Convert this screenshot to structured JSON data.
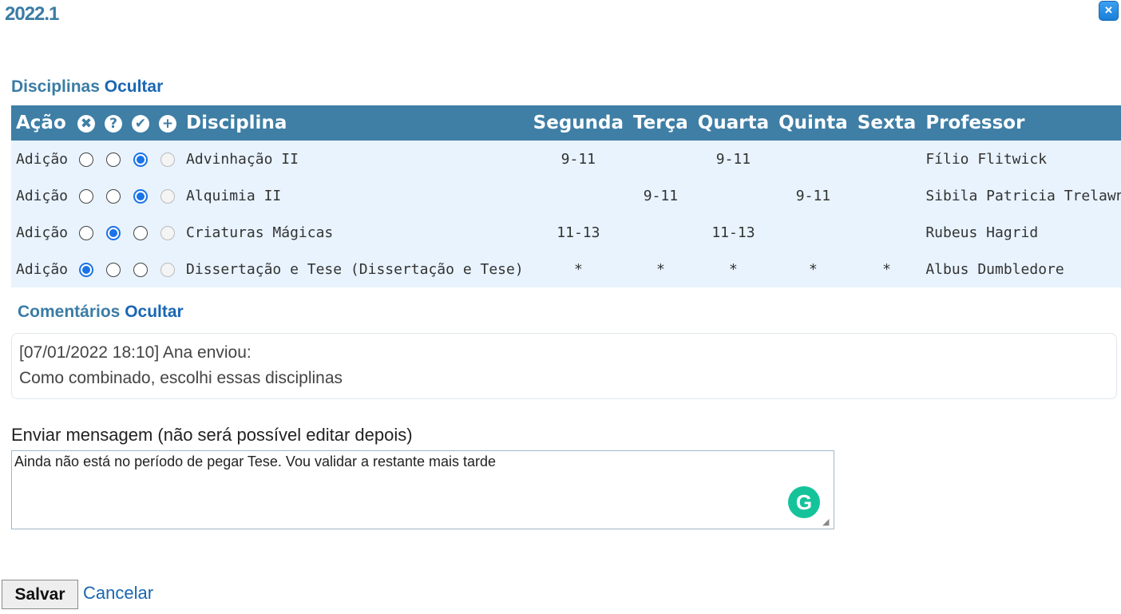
{
  "header": {
    "title": "2022.1",
    "close_icon": "close-icon"
  },
  "disciplinas": {
    "heading": "Disciplinas",
    "toggle_label": "Ocultar",
    "columns": {
      "acao": "Ação",
      "remove_icon": "✖",
      "question_icon": "?",
      "check_icon": "✔",
      "add_icon": "+",
      "disciplina": "Disciplina",
      "segunda": "Segunda",
      "terca": "Terça",
      "quarta": "Quarta",
      "quinta": "Quinta",
      "sexta": "Sexta",
      "professor": "Professor"
    },
    "rows": [
      {
        "acao": "Adição",
        "selected": "check",
        "disciplina": "Advinhação II",
        "segunda": "9-11",
        "terca": "",
        "quarta": "9-11",
        "quinta": "",
        "sexta": "",
        "professor": "Fílio Flitwick"
      },
      {
        "acao": "Adição",
        "selected": "check",
        "disciplina": "Alquimia II",
        "segunda": "",
        "terca": "9-11",
        "quarta": "",
        "quinta": "9-11",
        "sexta": "",
        "professor": "Sibila Patricia Trelawney"
      },
      {
        "acao": "Adição",
        "selected": "question",
        "disciplina": "Criaturas Mágicas",
        "segunda": "11-13",
        "terca": "",
        "quarta": "11-13",
        "quinta": "",
        "sexta": "",
        "professor": "Rubeus Hagrid"
      },
      {
        "acao": "Adição",
        "selected": "remove",
        "disciplina": "Dissertação e Tese (Dissertação e Tese)",
        "segunda": "*",
        "terca": "*",
        "quarta": "*",
        "quinta": "*",
        "sexta": "*",
        "professor": "Albus Dumbledore"
      }
    ]
  },
  "comentarios": {
    "heading": "Comentários",
    "toggle_label": "Ocultar",
    "entries": [
      {
        "meta": "[07/01/2022 18:10] Ana enviou:",
        "text": "Como combinado, escolhi essas disciplinas"
      }
    ]
  },
  "message": {
    "label": "Enviar mensagem (não será possível editar depois)",
    "value": "Ainda não está no período de pegar Tese. Vou validar a restante mais tarde"
  },
  "actions": {
    "save_label": "Salvar",
    "cancel_label": "Cancelar"
  },
  "colors": {
    "header_bg": "#3f7ea5",
    "row_bg": "#e8f3fd",
    "heading": "#3a7ca5",
    "link": "#1a66b3",
    "radio_on": "#1a73e8",
    "grammarly": "#15c39a"
  }
}
